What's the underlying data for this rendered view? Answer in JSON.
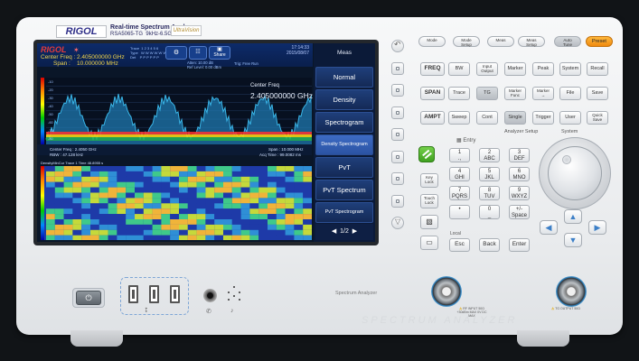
{
  "branding": {
    "logo": "RIGOL",
    "series_line1": "Real-time Spectrum Analyzer",
    "series_line2": "RSA5065-TG",
    "series_line3": "9kHz-6.5GHz",
    "ultra_logo": "UltraVision"
  },
  "screen": {
    "logo": "RIGOL",
    "center_freq_label": "Center Freq :",
    "center_freq_value": "2.405000000 GHz",
    "span_label": "Span :",
    "span_value": "10.000000 MHz",
    "trace_info": "Trace  1 2 3 4 5 6\nType   W W W W W W\nDet    P P P P P P",
    "atten": "Atten: 10.00 dB",
    "ref_level": "Ref Level: 0.00 dBm",
    "trig": "Trig: Free Run",
    "time": "17:14:33",
    "date": "2015/08/07",
    "icons": {
      "setup": "gear-icon",
      "ref": "ref-icon",
      "display_mode": "Share"
    },
    "spectrum": {
      "grid_labels": [
        "-10",
        "-20",
        "-30",
        "-40",
        "-50",
        "-60",
        "-70",
        "-80"
      ],
      "marker_title": "Center Freq",
      "marker_value": "2.405000000 GHz",
      "colors": {
        "accent": "#3ab6e8",
        "grid": "#2a4470"
      }
    },
    "footer": {
      "cf": "Center Freq : 2.4050 GHz",
      "rbw": "RBW : 47.128 kHz",
      "span": "Span : 10.000 MHz",
      "acq": "Acq Time : 99.0082 ms"
    },
    "spectrogram_title": "DensityMinCur Trace  1  Time  48.8955 s",
    "softkeys": {
      "title": "Meas",
      "items": [
        "Normal",
        "Density",
        "Spectrogram",
        "Density Spectrogram",
        "PvT",
        "PvT Spectrum",
        "PvT Spectrogram"
      ],
      "active": "Density Spectrogram",
      "page": "1/2"
    }
  },
  "panel": {
    "top_keys": [
      "Mode",
      "Mode Setup",
      "Meas",
      "Meas Setup",
      "Auto Tune",
      "Preset"
    ],
    "function_keys": [
      [
        "FREQ",
        "BW",
        "Input Output",
        "Marker",
        "Peak",
        "System",
        "Recall"
      ],
      [
        "SPAN",
        "Trace",
        "TG",
        "Marker Func",
        "Marker →",
        "File",
        "Save"
      ],
      [
        "AMPT",
        "Sweep",
        "Cont",
        "Single",
        "Trigger",
        "User",
        "Quick Save"
      ]
    ],
    "section_labels": {
      "entry": "Entry",
      "analyzer_setup": "Analyzer Setup",
      "system": "System",
      "local": "Local"
    },
    "side_keys": [
      "Key Lock",
      "Touch Lock",
      "Save Image",
      "Preset Screen"
    ],
    "keypad": [
      [
        "1\n.,",
        "2\nABC",
        "3\nDEF"
      ],
      [
        "4\nGHI",
        "5\nJKL",
        "6\nMNO"
      ],
      [
        "7\nPQRS",
        "8\nTUV",
        "9\nWXYZ"
      ],
      [
        "•",
        "0\n_",
        "+/-\nSpace"
      ]
    ],
    "bottom_keys": [
      "Esc",
      "Back",
      "Enter"
    ],
    "arrow_keys": [
      "▲",
      "◀",
      "▶",
      "▼",
      "▲",
      "▼"
    ]
  },
  "connectors": {
    "power_symbol": "⏻",
    "usb_symbol": "⭥",
    "headphone_symbol": "✆",
    "volume_symbol": "♪",
    "front_label": "Spectrum Analyzer",
    "watermark": "SPECTRUM ANALYZER",
    "warn_in": "RF INPUT 50Ω\n+30dBm MAX\n0V DC MAX",
    "warn_out": "TG OUTPUT\n50Ω"
  }
}
